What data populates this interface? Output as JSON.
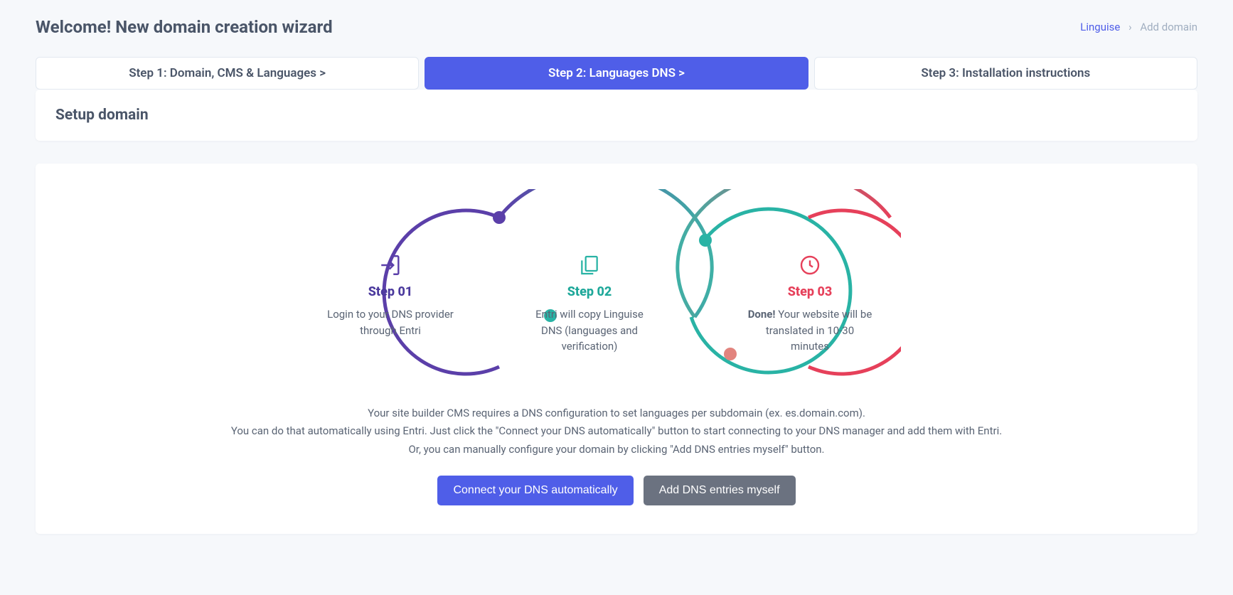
{
  "header": {
    "title": "Welcome! New domain creation wizard",
    "breadcrumb": {
      "link": "Linguise",
      "current": "Add domain"
    }
  },
  "steps": {
    "s1": "Step 1: Domain, CMS & Languages  >",
    "s2": "Step 2: Languages DNS  >",
    "s3": "Step 3: Installation instructions"
  },
  "setup": {
    "title": "Setup domain"
  },
  "flow": {
    "step1": {
      "title": "Step 01",
      "text": "Login to your DNS provider through Entri"
    },
    "step2": {
      "title": "Step 02",
      "text": "Entri will copy Linguise DNS (languages and verification)"
    },
    "step3": {
      "title": "Step 03",
      "bold": "Done!",
      "text": " Your website will be translated in 10-30 minutes"
    }
  },
  "description": {
    "line1": "Your site builder CMS requires a DNS configuration to set languages per subdomain (ex. es.domain.com).",
    "line2": "You can do that automatically using Entri. Just click the \"Connect your DNS automatically\" button to start connecting to your DNS manager and add them with Entri.",
    "line3": "Or, you can manually configure your domain by clicking \"Add DNS entries myself\" button."
  },
  "buttons": {
    "connect": "Connect your DNS automatically",
    "manual": "Add DNS entries myself"
  }
}
